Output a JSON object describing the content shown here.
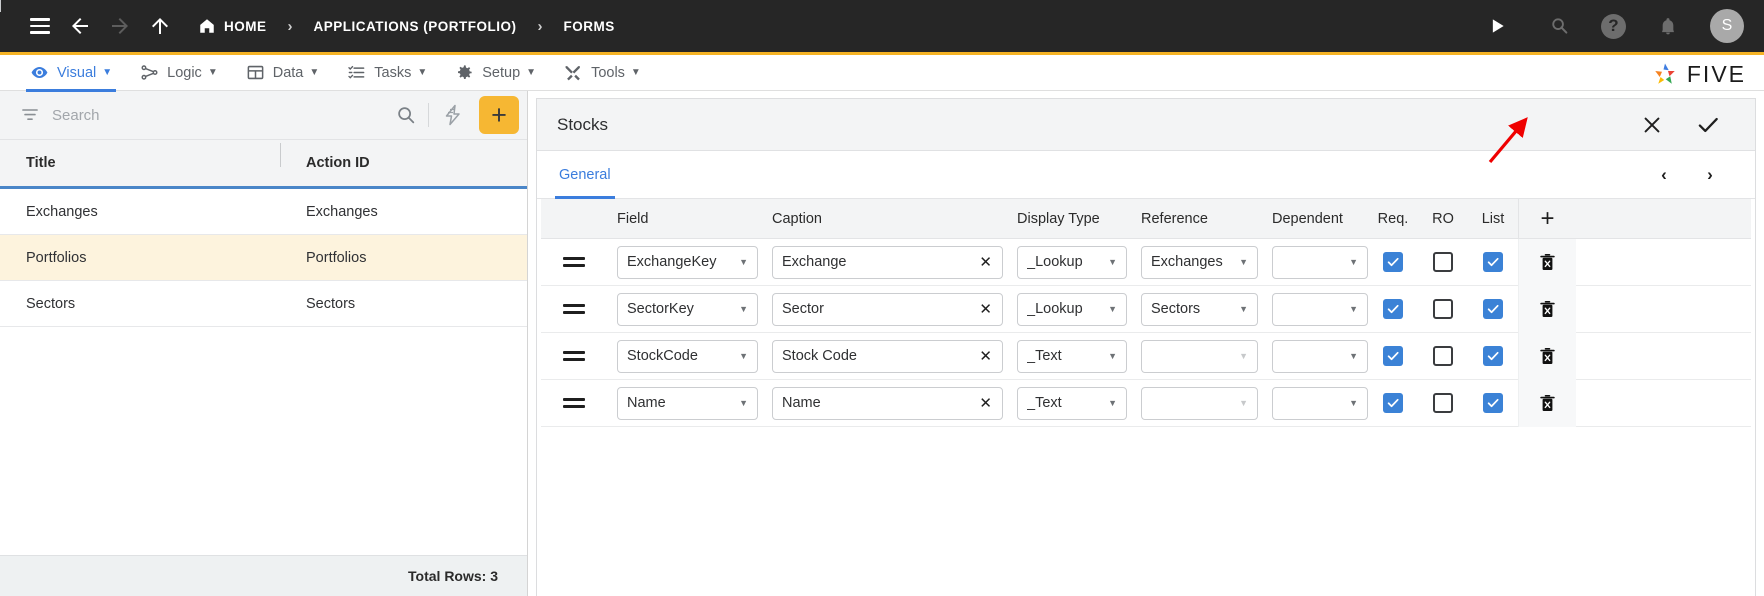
{
  "topbar": {
    "breadcrumbs": [
      {
        "label": "HOME",
        "icon": "home-icon"
      },
      {
        "label": "APPLICATIONS (PORTFOLIO)",
        "icon": ""
      },
      {
        "label": "FORMS",
        "icon": ""
      }
    ],
    "separator": "›",
    "icons": [
      "menu-icon",
      "back-arrow-icon",
      "forward-arrow-icon",
      "up-arrow-icon"
    ],
    "right_icons": [
      "run-icon",
      "search-icon",
      "help-icon",
      "notifications-icon"
    ],
    "avatar_initial": "S"
  },
  "nav": {
    "items": [
      {
        "label": "Visual",
        "icon": "eye-icon",
        "caret": "▼",
        "active": true
      },
      {
        "label": "Logic",
        "icon": "logic-icon",
        "caret": "▼",
        "active": false
      },
      {
        "label": "Data",
        "icon": "table-icon",
        "caret": "▼",
        "active": false
      },
      {
        "label": "Tasks",
        "icon": "tasks-icon",
        "caret": "▼",
        "active": false
      },
      {
        "label": "Setup",
        "icon": "gear-icon",
        "caret": "▼",
        "active": false
      },
      {
        "label": "Tools",
        "icon": "tools-icon",
        "caret": "▼",
        "active": false
      }
    ],
    "brand": "FIVE"
  },
  "colors": {
    "accent_amber": "#f5b325",
    "accent_blue": "#3b7ddd",
    "checkbox_blue": "#3b82d6",
    "selected_row": "#fdf3dd",
    "annotation_red": "#ef0000",
    "topbar_bg": "#262626"
  },
  "left_panel": {
    "search": {
      "value": "",
      "placeholder": "Search"
    },
    "buttons": {
      "filter": "filter-icon",
      "search": "search-icon",
      "bolt": "bolt-icon",
      "add": "+"
    },
    "columns": [
      "Title",
      "Action ID"
    ],
    "rows": [
      {
        "title": "Exchanges",
        "action_id": "Exchanges",
        "selected": false
      },
      {
        "title": "Portfolios",
        "action_id": "Portfolios",
        "selected": true
      },
      {
        "title": "Sectors",
        "action_id": "Sectors",
        "selected": false
      }
    ],
    "footer": "Total Rows: 3"
  },
  "form": {
    "title": "Stocks",
    "actions": {
      "cancel": "close-icon",
      "save": "check-icon"
    },
    "tabs": [
      {
        "label": "General",
        "active": true
      }
    ],
    "pager": {
      "prev": "‹",
      "next": "›"
    },
    "grid": {
      "columns": [
        "Field",
        "Caption",
        "Display Type",
        "Reference",
        "Dependent",
        "Req.",
        "RO",
        "List"
      ],
      "add_column_label": "+",
      "rows": [
        {
          "handle": "drag-handle",
          "field": "ExchangeKey",
          "caption": "Exchange",
          "display_type": "_Lookup",
          "reference": "Exchanges",
          "reference_enabled": true,
          "dependent": "",
          "req": true,
          "ro": false,
          "list": true,
          "delete": "delete-icon"
        },
        {
          "handle": "drag-handle",
          "field": "SectorKey",
          "caption": "Sector",
          "display_type": "_Lookup",
          "reference": "Sectors",
          "reference_enabled": true,
          "dependent": "",
          "req": true,
          "ro": false,
          "list": true,
          "delete": "delete-icon"
        },
        {
          "handle": "drag-handle",
          "field": "StockCode",
          "caption": "Stock Code",
          "display_type": "_Text",
          "reference": "",
          "reference_enabled": false,
          "dependent": "",
          "req": true,
          "ro": false,
          "list": true,
          "delete": "delete-icon"
        },
        {
          "handle": "drag-handle",
          "field": "Name",
          "caption": "Name",
          "display_type": "_Text",
          "reference": "",
          "reference_enabled": false,
          "dependent": "",
          "req": true,
          "ro": false,
          "list": true,
          "delete": "delete-icon"
        }
      ]
    }
  },
  "annotation": {
    "type": "red-arrow",
    "points_to": "save-check-button"
  }
}
